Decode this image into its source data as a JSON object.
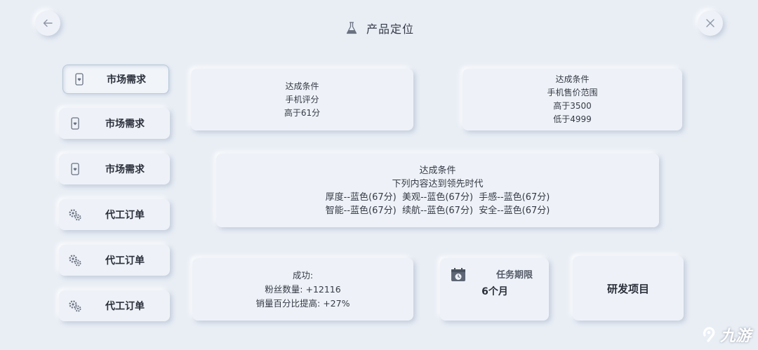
{
  "header": {
    "title": "产品定位",
    "icon": "flask-icon"
  },
  "nav": {
    "back_icon": "arrow-left-icon",
    "close_icon": "close-icon"
  },
  "sidebar": {
    "items": [
      {
        "label": "市场需求",
        "icon": "phone-heart-icon",
        "active": true
      },
      {
        "label": "市场需求",
        "icon": "phone-heart-icon",
        "active": false
      },
      {
        "label": "市场需求",
        "icon": "phone-heart-icon",
        "active": false
      },
      {
        "label": "代工订单",
        "icon": "gear-cluster-icon",
        "active": false
      },
      {
        "label": "代工订单",
        "icon": "gear-cluster-icon",
        "active": false
      },
      {
        "label": "代工订单",
        "icon": "gear-cluster-icon",
        "active": false
      }
    ]
  },
  "conditions": {
    "score": {
      "lines": [
        "达成条件",
        "手机评分",
        "高于61分"
      ]
    },
    "price": {
      "lines": [
        "达成条件",
        "手机售价范围",
        "高于3500",
        "低于4999"
      ]
    },
    "specs": {
      "lines": [
        "达成条件",
        "下列内容达到领先时代",
        "厚度--蓝色(67分)  美观--蓝色(67分)  手感--蓝色(67分)",
        "智能--蓝色(67分)  续航--蓝色(67分)  安全--蓝色(67分)"
      ]
    }
  },
  "reward": {
    "lines": [
      "成功:",
      "粉丝数量: +12116",
      "销量百分比提高: +27%"
    ]
  },
  "deadline": {
    "label": "任务期限",
    "value": "6个月",
    "icon": "calendar-clock-icon"
  },
  "action": {
    "label": "研发项目"
  },
  "watermark": {
    "text": "九游"
  },
  "colors": {
    "background": "#e9eef5",
    "card": "#eef2f8",
    "active_border": "#b7c7d8"
  }
}
